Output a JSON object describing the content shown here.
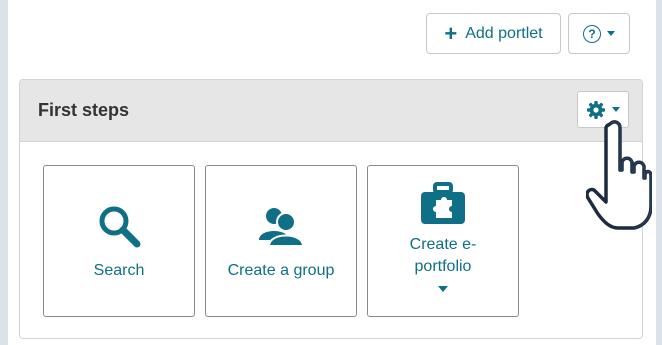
{
  "toolbar": {
    "add_portlet_label": "Add portlet",
    "help_icon": "question-circle-icon"
  },
  "portlet": {
    "title": "First steps",
    "settings_icon": "gear-icon"
  },
  "tiles": [
    {
      "label": "Search",
      "icon": "search-icon"
    },
    {
      "label": "Create a group",
      "icon": "group-icon"
    },
    {
      "label": "Create e-portfolio",
      "icon": "portfolio-icon"
    }
  ],
  "colors": {
    "accent": "#0e6f86",
    "header_bg": "#e6e6e6",
    "outer_bg": "#dbe3ea"
  }
}
